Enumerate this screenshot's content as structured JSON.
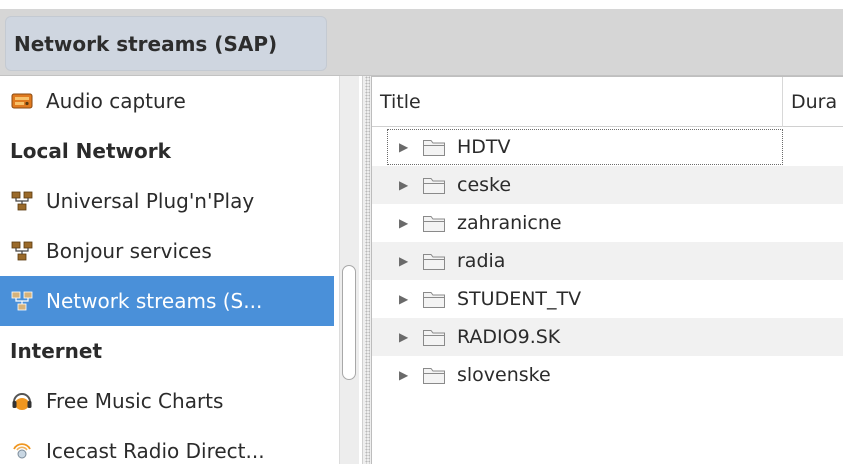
{
  "header": {
    "title": "Network streams (SAP)"
  },
  "sidebar": {
    "items": [
      {
        "kind": "item",
        "label": "Audio capture",
        "icon": "audio-capture-icon"
      },
      {
        "kind": "header",
        "label": "Local Network"
      },
      {
        "kind": "item",
        "label": "Universal Plug'n'Play",
        "icon": "network-icon"
      },
      {
        "kind": "item",
        "label": "Bonjour services",
        "icon": "network-icon"
      },
      {
        "kind": "item",
        "label": "Network streams (S...",
        "icon": "network-icon",
        "selected": true
      },
      {
        "kind": "header",
        "label": "Internet"
      },
      {
        "kind": "item",
        "label": "Free Music Charts",
        "icon": "headphones-icon"
      },
      {
        "kind": "item",
        "label": "Icecast Radio Direct...",
        "icon": "radio-icon"
      }
    ]
  },
  "playlist": {
    "columns": {
      "title": "Title",
      "duration": "Dura"
    },
    "rows": [
      {
        "label": "HDTV"
      },
      {
        "label": "ceske"
      },
      {
        "label": "zahranicne"
      },
      {
        "label": "radia"
      },
      {
        "label": "STUDENT_TV"
      },
      {
        "label": "RADIO9.SK"
      },
      {
        "label": "slovenske"
      }
    ]
  },
  "colors": {
    "selected_bg": "#4a90d9",
    "header_bg": "#d6d6d6",
    "title_box": "#cfd6e0"
  }
}
